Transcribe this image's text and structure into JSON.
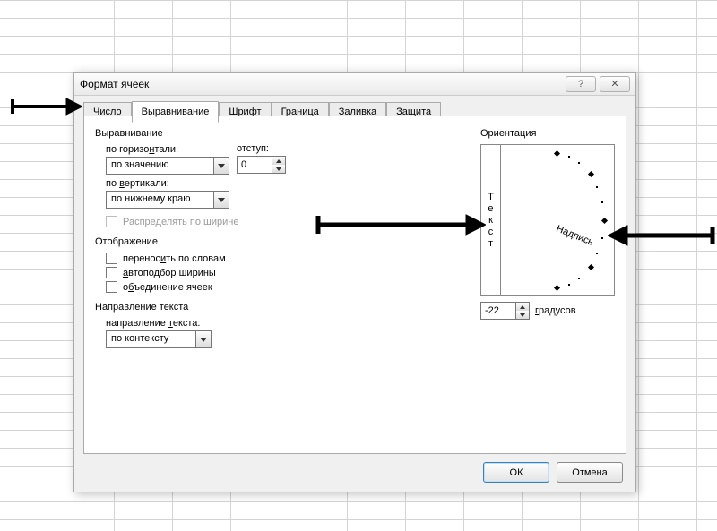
{
  "dialog": {
    "title": "Формат ячеек"
  },
  "tabs": [
    "Число",
    "Выравнивание",
    "Шрифт",
    "Граница",
    "Заливка",
    "Защита"
  ],
  "left": {
    "group_align": "Выравнивание",
    "hlabel_pre": "по горизо",
    "hlabel_u": "н",
    "hlabel_post": "тали:",
    "hvalue": "по значению",
    "indent_label": "отступ:",
    "indent_value": "0",
    "vlabel_pre": "по ",
    "vlabel_u": "в",
    "vlabel_post": "ертикали:",
    "vvalue": "по нижнему краю",
    "distribute": "Распределять по ширине",
    "group_display": "Отображение",
    "wrap_pre": "перенос",
    "wrap_u": "и",
    "wrap_post": "ть по словам",
    "autofit_u": "а",
    "autofit_post": "втоподбор ширины",
    "merge_pre": "о",
    "merge_u": "б",
    "merge_post": "ъединение ячеек",
    "group_dir": "Направление текста",
    "dir_label_pre": "направление ",
    "dir_label_u": "т",
    "dir_label_post": "екста:",
    "dir_value": "по контексту"
  },
  "right": {
    "group": "Ориентация",
    "vertical_chars": [
      "Т",
      "е",
      "к",
      "с",
      "т"
    ],
    "nadpis": "Надпись",
    "degrees_value": "-22",
    "degrees_label_u": "г",
    "degrees_label_post": "радусов"
  },
  "buttons": {
    "ok": "ОК",
    "cancel": "Отмена"
  }
}
